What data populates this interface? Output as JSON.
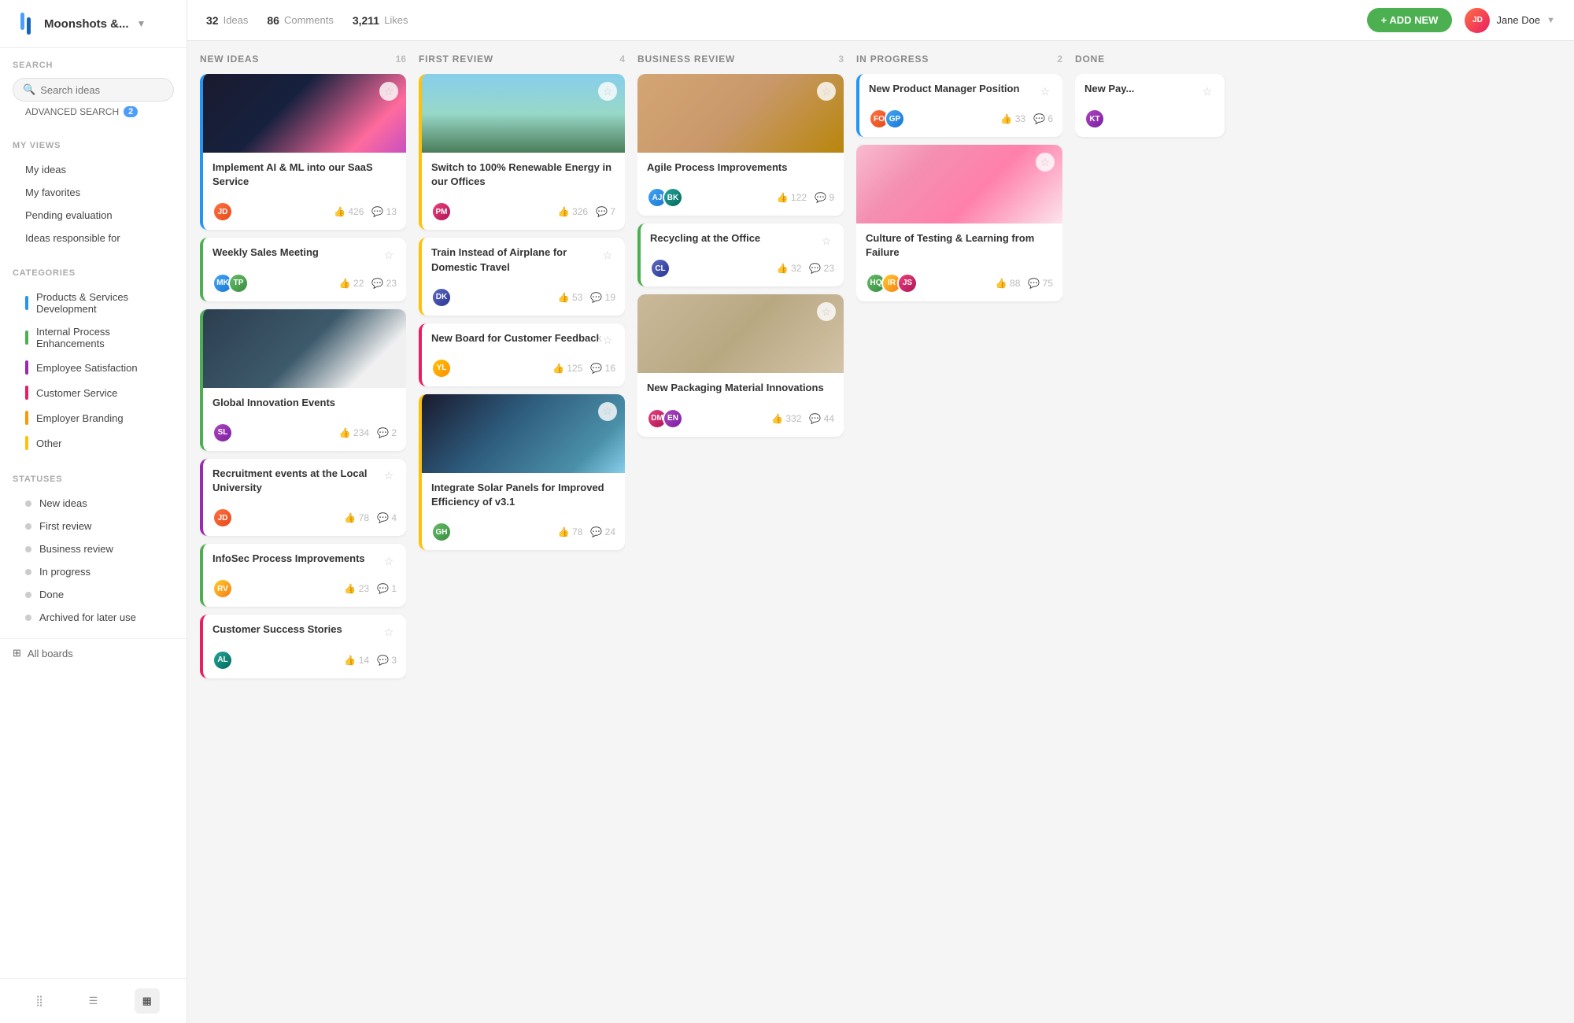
{
  "app": {
    "name": "Moonshots &...",
    "logo_alt": "Moonshots logo"
  },
  "topbar": {
    "stats": {
      "ideas_count": "32",
      "ideas_label": "Ideas",
      "comments_count": "86",
      "comments_label": "Comments",
      "likes_count": "3,211",
      "likes_label": "Likes"
    },
    "add_button": "+ ADD NEW",
    "user_name": "Jane Doe"
  },
  "sidebar": {
    "search_section": "SEARCH",
    "search_placeholder": "Search ideas",
    "advanced_search": "ADVANCED SEARCH",
    "advanced_badge": "2",
    "my_views_section": "MY VIEWS",
    "my_views": [
      {
        "label": "My ideas"
      },
      {
        "label": "My favorites"
      },
      {
        "label": "Pending evaluation"
      },
      {
        "label": "Ideas responsible for"
      }
    ],
    "categories_section": "CATEGORIES",
    "categories": [
      {
        "label": "Products & Services Development",
        "color": "#2196f3"
      },
      {
        "label": "Internal Process Enhancements",
        "color": "#4caf50"
      },
      {
        "label": "Employee Satisfaction",
        "color": "#9c27b0"
      },
      {
        "label": "Customer Service",
        "color": "#e91e63"
      },
      {
        "label": "Employer Branding",
        "color": "#ff9800"
      },
      {
        "label": "Other",
        "color": "#ffc107"
      }
    ],
    "statuses_section": "STATUSES",
    "statuses": [
      {
        "label": "New ideas"
      },
      {
        "label": "First review"
      },
      {
        "label": "Business review"
      },
      {
        "label": "In progress"
      },
      {
        "label": "Done"
      },
      {
        "label": "Archived for later use"
      }
    ],
    "all_boards": "All boards"
  },
  "columns": [
    {
      "id": "new-ideas",
      "title": "NEW IDEAS",
      "count": "16",
      "cards": [
        {
          "id": "c1",
          "title": "Implement AI & ML into our SaaS Service",
          "has_image": true,
          "image_class": "img-neural",
          "border": "blue-border",
          "likes": "426",
          "comments": "13",
          "avatars": [
            {
              "class": "av1",
              "text": "JD"
            }
          ]
        },
        {
          "id": "c2",
          "title": "Weekly Sales Meeting",
          "has_image": false,
          "border": "green-border",
          "likes": "22",
          "comments": "23",
          "avatars": [
            {
              "class": "av2",
              "text": "MK"
            },
            {
              "class": "av3",
              "text": "TP"
            }
          ]
        },
        {
          "id": "c3",
          "title": "Global Innovation Events",
          "has_image": true,
          "image_class": "img-meeting",
          "border": "green-border",
          "likes": "234",
          "comments": "2",
          "avatars": [
            {
              "class": "av4",
              "text": "SL"
            }
          ]
        },
        {
          "id": "c4",
          "title": "Recruitment events at the Local University",
          "has_image": false,
          "border": "purple-border",
          "likes": "78",
          "comments": "4",
          "avatars": [
            {
              "class": "av1",
              "text": "JD"
            }
          ]
        },
        {
          "id": "c5",
          "title": "InfoSec Process Improvements",
          "has_image": false,
          "border": "green-border",
          "likes": "23",
          "comments": "1",
          "avatars": [
            {
              "class": "av5",
              "text": "RV"
            }
          ]
        },
        {
          "id": "c6",
          "title": "Customer Success Stories",
          "has_image": false,
          "border": "pink-border",
          "likes": "14",
          "comments": "3",
          "avatars": [
            {
              "class": "av6",
              "text": "AL"
            }
          ]
        }
      ]
    },
    {
      "id": "first-review",
      "title": "FIRST REVIEW",
      "count": "4",
      "cards": [
        {
          "id": "c7",
          "title": "Switch to 100% Renewable Energy in our Offices",
          "has_image": true,
          "image_class": "img-wind",
          "border": "yellow-border",
          "likes": "326",
          "comments": "7",
          "avatars": [
            {
              "class": "av7",
              "text": "PM"
            }
          ]
        },
        {
          "id": "c8",
          "title": "Train Instead of Airplane for Domestic Travel",
          "has_image": false,
          "border": "yellow-border",
          "likes": "53",
          "comments": "19",
          "avatars": [
            {
              "class": "av8",
              "text": "DK"
            }
          ]
        },
        {
          "id": "c9",
          "title": "New Board for Customer Feedback",
          "has_image": false,
          "border": "pink-border",
          "likes": "125",
          "comments": "16",
          "avatars": [
            {
              "class": "av5",
              "text": "YL"
            }
          ]
        },
        {
          "id": "c10",
          "title": "Integrate Solar Panels for Improved Efficiency of v3.1",
          "has_image": true,
          "image_class": "img-solar",
          "border": "yellow-border",
          "likes": "78",
          "comments": "24",
          "avatars": [
            {
              "class": "av3",
              "text": "GH"
            }
          ]
        }
      ]
    },
    {
      "id": "business-review",
      "title": "BUSINESS REVIEW",
      "count": "3",
      "cards": [
        {
          "id": "c11",
          "title": "Agile Process Improvements",
          "has_image": true,
          "image_class": "img-boxes",
          "border": "no-border",
          "likes": "122",
          "comments": "9",
          "avatars": [
            {
              "class": "av2",
              "text": "AJ"
            },
            {
              "class": "av6",
              "text": "BK"
            }
          ]
        },
        {
          "id": "c12",
          "title": "Recycling at the Office",
          "has_image": false,
          "border": "green-border",
          "likes": "32",
          "comments": "23",
          "avatars": [
            {
              "class": "av8",
              "text": "CL"
            }
          ]
        },
        {
          "id": "c13",
          "title": "New Packaging Material Innovations",
          "has_image": true,
          "image_class": "img-packaging",
          "border": "no-border",
          "likes": "332",
          "comments": "44",
          "avatars": [
            {
              "class": "av7",
              "text": "DM"
            },
            {
              "class": "av4",
              "text": "EN"
            }
          ]
        }
      ]
    },
    {
      "id": "in-progress",
      "title": "IN PROGRESS",
      "count": "2",
      "cards": [
        {
          "id": "c14",
          "title": "New Product Manager Position",
          "has_image": false,
          "border": "blue-border",
          "likes": "33",
          "comments": "6",
          "avatars": [
            {
              "class": "av1",
              "text": "FO"
            },
            {
              "class": "av2",
              "text": "GP"
            }
          ]
        },
        {
          "id": "c15",
          "title": "Culture of Testing & Learning from Failure",
          "has_image": true,
          "image_class": "img-sticky",
          "border": "no-border",
          "likes": "88",
          "comments": "75",
          "avatars": [
            {
              "class": "av3",
              "text": "HQ"
            },
            {
              "class": "av5",
              "text": "IR"
            },
            {
              "class": "av7",
              "text": "JS"
            }
          ]
        }
      ]
    },
    {
      "id": "done",
      "title": "DONE",
      "count": "",
      "cards": [
        {
          "id": "c16",
          "title": "New Pay...",
          "has_image": false,
          "border": "no-border",
          "likes": "",
          "comments": "",
          "avatars": [
            {
              "class": "av4",
              "text": "KT"
            }
          ]
        }
      ]
    }
  ]
}
